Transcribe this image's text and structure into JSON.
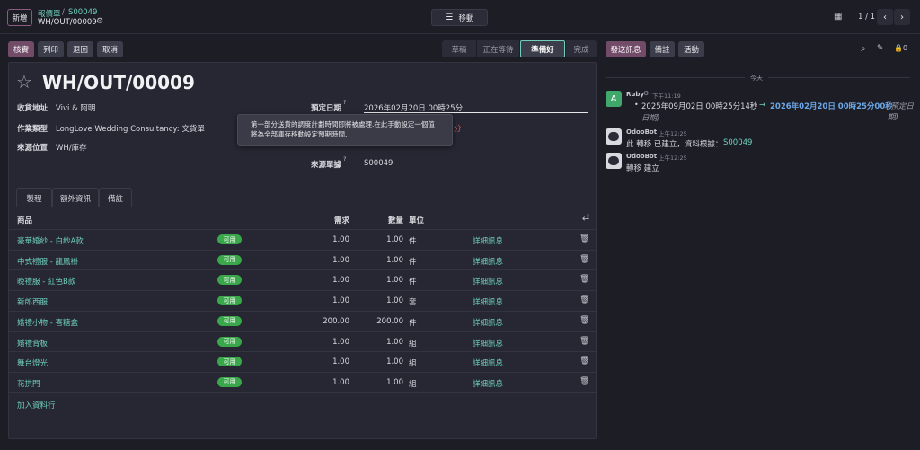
{
  "topbar": {
    "new_label": "新增",
    "breadcrumb_parent": "報價單",
    "breadcrumb_sep": "/",
    "breadcrumb_ref": "S00049",
    "record_title": "WH/OUT/00009",
    "move_label": "移動",
    "pager": "1 / 1"
  },
  "actions": {
    "validate": "核實",
    "print": "列印",
    "return": "退回",
    "cancel": "取消"
  },
  "status_steps": [
    "草稿",
    "正在等待",
    "準備好",
    "完成"
  ],
  "chatter_actions": {
    "send": "發送訊息",
    "note": "備註",
    "activity": "活動"
  },
  "form": {
    "title": "WH/OUT/00009",
    "delivery_address_label": "收貨地址",
    "delivery_address": "Vivi & 阿明",
    "operation_type_label": "作業類型",
    "operation_type": "LongLove Wedding Consultancy: 交貨單",
    "source_location_label": "來源位置",
    "source_location": "WH/庫存",
    "scheduled_date_label": "預定日期",
    "scheduled_date": "2026年02月20日 00時25分",
    "source_doc_label": "來源單據",
    "source_doc": "S00049",
    "help_mark": "?",
    "tooltip": "第一部分送貨的調度計劃時間即將被處理.在此手動設定一個值將為全部庫存移動設定預期時間."
  },
  "tabs": [
    "製程",
    "額外資訊",
    "備註"
  ],
  "table": {
    "headers": {
      "product": "商品",
      "demand": "需求",
      "quantity": "數量",
      "unit": "單位"
    },
    "available_label": "可用",
    "details_label": "詳細訊息",
    "rows": [
      {
        "product": "豪華婚紗 - 白紗A款",
        "demand": "1.00",
        "quantity": "1.00",
        "unit": "件"
      },
      {
        "product": "中式禮服 - 龍鳳褂",
        "demand": "1.00",
        "quantity": "1.00",
        "unit": "件"
      },
      {
        "product": "晚禮服 - 紅色B款",
        "demand": "1.00",
        "quantity": "1.00",
        "unit": "件"
      },
      {
        "product": "新郎西服",
        "demand": "1.00",
        "quantity": "1.00",
        "unit": "套"
      },
      {
        "product": "婚禮小物 - 喜糖盒",
        "demand": "200.00",
        "quantity": "200.00",
        "unit": "件"
      },
      {
        "product": "婚禮背板",
        "demand": "1.00",
        "quantity": "1.00",
        "unit": "組"
      },
      {
        "product": "舞台燈光",
        "demand": "1.00",
        "quantity": "1.00",
        "unit": "組"
      },
      {
        "product": "花拱門",
        "demand": "1.00",
        "quantity": "1.00",
        "unit": "組"
      }
    ],
    "add_line": "加入資料行"
  },
  "chatter": {
    "date_divider": "今天",
    "messages": [
      {
        "author": "Ruby",
        "avatar": "A",
        "time": "下午11:19",
        "old_value": "2025年09月02日 00時25分14秒",
        "arrow": "→",
        "new_value": "2026年02月20日 00時25分00秒",
        "field": "(預定日期)"
      },
      {
        "author": "OdooBot",
        "time": "上午12:25",
        "prefix": "此 轉移 已建立，資料根據：",
        "link": "S00049"
      },
      {
        "author": "OdooBot",
        "time": "上午12:25",
        "text": "轉移 建立"
      }
    ]
  },
  "colors": {
    "accent": "#714b67",
    "link": "#6fcfbc",
    "available": "#39a74a",
    "danger": "#e0595b"
  }
}
